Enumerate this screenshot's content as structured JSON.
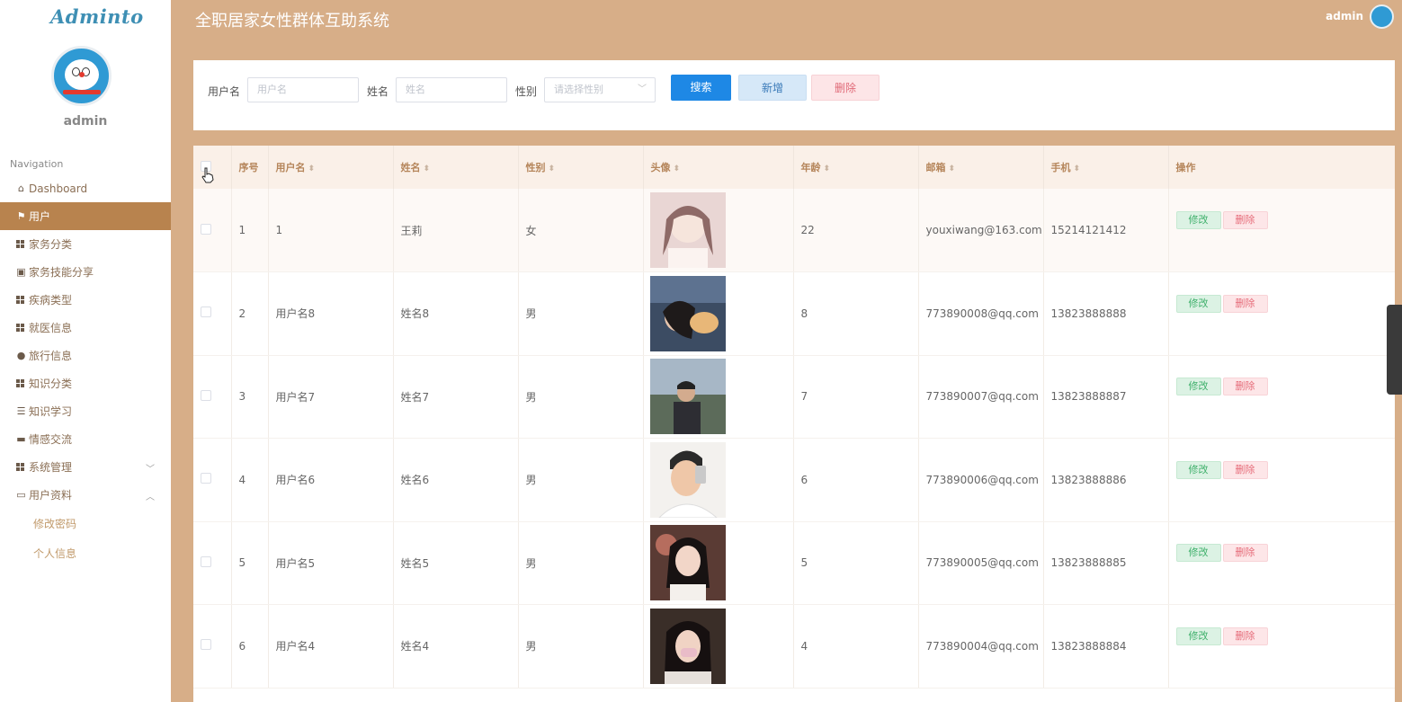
{
  "sidebar": {
    "logo": "Adminto",
    "user_name": "admin",
    "nav_title": "Navigation",
    "items": [
      {
        "label": "Dashboard",
        "icon": "home-icon"
      },
      {
        "label": "用户",
        "icon": "flag-icon",
        "active": true
      },
      {
        "label": "家务分类",
        "icon": "grid-icon"
      },
      {
        "label": "家务技能分享",
        "icon": "clipboard-icon"
      },
      {
        "label": "疾病类型",
        "icon": "grid-icon"
      },
      {
        "label": "就医信息",
        "icon": "grid-icon"
      },
      {
        "label": "旅行信息",
        "icon": "user-icon"
      },
      {
        "label": "知识分类",
        "icon": "grid-icon"
      },
      {
        "label": "知识学习",
        "icon": "sliders-icon"
      },
      {
        "label": "情感交流",
        "icon": "monitor-icon"
      },
      {
        "label": "系统管理",
        "icon": "grid-icon",
        "chevron": "down"
      },
      {
        "label": "用户资料",
        "icon": "calendar-icon",
        "chevron": "up"
      }
    ],
    "sub_items": [
      "修改密码",
      "个人信息"
    ]
  },
  "header": {
    "title": "全职居家女性群体互助系统",
    "user": "admin"
  },
  "search": {
    "username_label": "用户名",
    "username_placeholder": "用户名",
    "name_label": "姓名",
    "name_placeholder": "姓名",
    "gender_label": "性别",
    "gender_placeholder": "请选择性别",
    "search_btn": "搜索",
    "add_btn": "新增",
    "delete_btn": "删除"
  },
  "table": {
    "columns": [
      "序号",
      "用户名",
      "姓名",
      "性别",
      "头像",
      "年龄",
      "邮箱",
      "手机",
      "操作"
    ],
    "edit_label": "修改",
    "delete_label": "删除",
    "rows": [
      {
        "idx": "1",
        "username": "1",
        "name": "王莉",
        "gender": "女",
        "age": "22",
        "email": "youxiwang@163.com",
        "phone": "15214121412"
      },
      {
        "idx": "2",
        "username": "用户名8",
        "name": "姓名8",
        "gender": "男",
        "age": "8",
        "email": "773890008@qq.com",
        "phone": "13823888888"
      },
      {
        "idx": "3",
        "username": "用户名7",
        "name": "姓名7",
        "gender": "男",
        "age": "7",
        "email": "773890007@qq.com",
        "phone": "13823888887"
      },
      {
        "idx": "4",
        "username": "用户名6",
        "name": "姓名6",
        "gender": "男",
        "age": "6",
        "email": "773890006@qq.com",
        "phone": "13823888886"
      },
      {
        "idx": "5",
        "username": "用户名5",
        "name": "姓名5",
        "gender": "男",
        "age": "5",
        "email": "773890005@qq.com",
        "phone": "13823888885"
      },
      {
        "idx": "6",
        "username": "用户名4",
        "name": "姓名4",
        "gender": "男",
        "age": "4",
        "email": "773890004@qq.com",
        "phone": "13823888884"
      }
    ]
  },
  "colors": {
    "accent": "#d7ae88",
    "sidebar_active": "#b8834e",
    "primary_button": "#1e88e5"
  }
}
